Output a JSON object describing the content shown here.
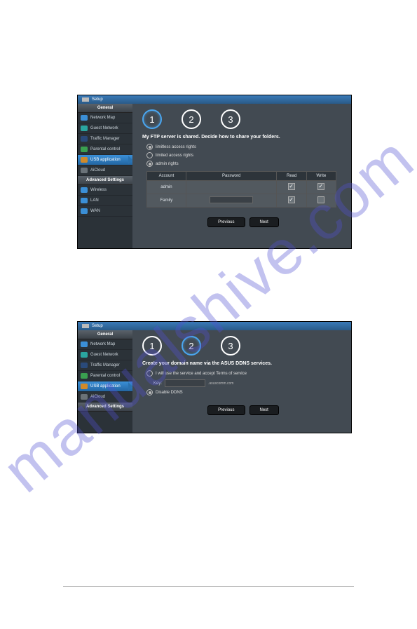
{
  "watermark": "manualshive.com",
  "topbar": {
    "label": "Setup"
  },
  "sidebar": {
    "general_header": "General",
    "advanced_header": "Advanced Settings",
    "items": {
      "network_map": "Network Map",
      "guest_network": "Guest Network",
      "traffic_manager": "Traffic Manager",
      "parental_control": "Parental control",
      "usb_application": "USB application",
      "aicloud": "AiCloud",
      "wireless": "Wireless",
      "lan": "LAN",
      "wan": "WAN"
    }
  },
  "steps": {
    "one": "1",
    "two": "2",
    "three": "3"
  },
  "screen1": {
    "instruction": "My FTP server is shared. Decide how to share your folders.",
    "options": {
      "limitless": "limitless access rights",
      "limited": "limited access rights",
      "admin": "admin rights"
    },
    "table": {
      "headers": {
        "account": "Account",
        "password": "Password",
        "read": "Read",
        "write": "Write"
      },
      "rows": [
        {
          "account": "admin",
          "password_label": "",
          "read": true,
          "write": true
        },
        {
          "account": "Family",
          "password_label": "Family",
          "read": true,
          "write": false
        }
      ]
    },
    "buttons": {
      "previous": "Previous",
      "next": "Next"
    }
  },
  "screen2": {
    "instruction": "Create your domain name via the ASUS DDNS services.",
    "options": {
      "accept_terms": "I will use the service and accept Terms of service",
      "key_label": "Key:",
      "domain_suffix": ".asuscomm.com",
      "disable_ddns": "Disable DDNS"
    },
    "buttons": {
      "previous": "Previous",
      "next": "Next"
    }
  }
}
